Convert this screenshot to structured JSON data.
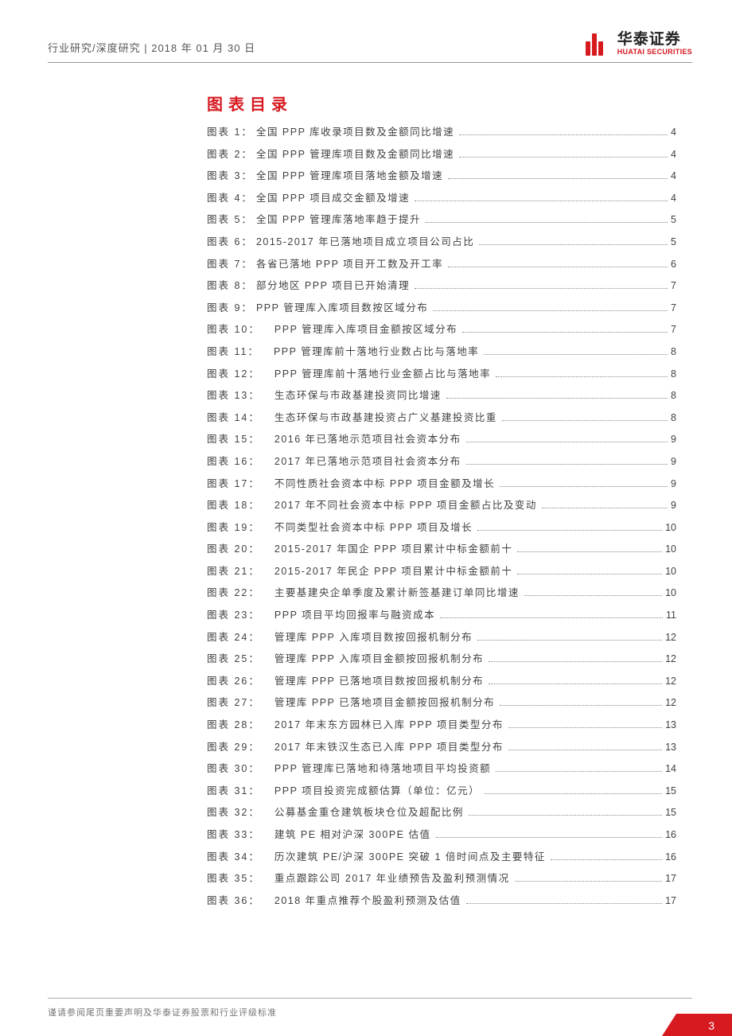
{
  "header": {
    "breadcrumb": "行业研究/深度研究 | 2018 年 01 月 30 日"
  },
  "logo": {
    "cn": "华泰证券",
    "en": "HUATAI SECURITIES"
  },
  "tocTitle": "图表目录",
  "toc": [
    {
      "label": "图表 1：",
      "text": "全国 PPP 库收录项目数及金额同比增速",
      "page": "4"
    },
    {
      "label": "图表 2：",
      "text": "全国 PPP 管理库项目数及金额同比增速",
      "page": "4"
    },
    {
      "label": "图表 3：",
      "text": "全国 PPP 管理库项目落地金额及增速",
      "page": "4"
    },
    {
      "label": "图表 4：",
      "text": "全国 PPP 项目成交金额及增速",
      "page": "4"
    },
    {
      "label": "图表 5：",
      "text": "全国 PPP 管理库落地率趋于提升",
      "page": "5"
    },
    {
      "label": "图表 6：",
      "text": "2015-2017 年已落地项目成立项目公司占比",
      "page": "5"
    },
    {
      "label": "图表 7：",
      "text": "各省已落地 PPP 项目开工数及开工率",
      "page": "6"
    },
    {
      "label": "图表 8：",
      "text": "部分地区 PPP 项目已开始清理",
      "page": "7"
    },
    {
      "label": "图表 9：",
      "text": "PPP 管理库入库项目数按区域分布",
      "page": "7"
    },
    {
      "label": "图表 10：",
      "text": "PPP 管理库入库项目金额按区域分布",
      "page": "7"
    },
    {
      "label": "图表 11：",
      "text": "PPP 管理库前十落地行业数占比与落地率",
      "page": "8"
    },
    {
      "label": "图表 12：",
      "text": "PPP 管理库前十落地行业金额占比与落地率",
      "page": "8"
    },
    {
      "label": "图表 13：",
      "text": "生态环保与市政基建投资同比增速",
      "page": "8"
    },
    {
      "label": "图表 14：",
      "text": "生态环保与市政基建投资占广义基建投资比重",
      "page": "8"
    },
    {
      "label": "图表 15：",
      "text": "2016 年已落地示范项目社会资本分布",
      "page": "9"
    },
    {
      "label": "图表 16：",
      "text": "2017 年已落地示范项目社会资本分布",
      "page": "9"
    },
    {
      "label": "图表 17：",
      "text": "不同性质社会资本中标 PPP 项目金额及增长",
      "page": "9"
    },
    {
      "label": "图表 18：",
      "text": "2017 年不同社会资本中标 PPP 项目金额占比及变动",
      "page": "9"
    },
    {
      "label": "图表 19：",
      "text": "不同类型社会资本中标 PPP 项目及增长",
      "page": "10"
    },
    {
      "label": "图表 20：",
      "text": "2015-2017 年国企 PPP 项目累计中标金额前十",
      "page": "10"
    },
    {
      "label": "图表 21：",
      "text": "2015-2017 年民企 PPP 项目累计中标金额前十",
      "page": "10"
    },
    {
      "label": "图表 22：",
      "text": "主要基建央企单季度及累计新签基建订单同比增速",
      "page": "10"
    },
    {
      "label": "图表 23：",
      "text": "PPP 项目平均回报率与融资成本",
      "page": "11"
    },
    {
      "label": "图表 24：",
      "text": "管理库 PPP 入库项目数按回报机制分布",
      "page": "12"
    },
    {
      "label": "图表 25：",
      "text": "管理库 PPP 入库项目金额按回报机制分布",
      "page": "12"
    },
    {
      "label": "图表 26：",
      "text": "管理库 PPP 已落地项目数按回报机制分布",
      "page": "12"
    },
    {
      "label": "图表 27：",
      "text": "管理库 PPP 已落地项目金额按回报机制分布",
      "page": "12"
    },
    {
      "label": "图表 28：",
      "text": "2017 年末东方园林已入库 PPP 项目类型分布",
      "page": "13"
    },
    {
      "label": "图表 29：",
      "text": "2017 年末铁汉生态已入库 PPP 项目类型分布",
      "page": "13"
    },
    {
      "label": "图表 30：",
      "text": "PPP 管理库已落地和待落地项目平均投资额",
      "page": "14"
    },
    {
      "label": "图表 31：",
      "text": "PPP 项目投资完成额估算（单位：亿元）",
      "page": "15"
    },
    {
      "label": "图表 32：",
      "text": "公募基金重仓建筑板块仓位及超配比例",
      "page": "15"
    },
    {
      "label": "图表 33：",
      "text": "建筑 PE 相对沪深 300PE 估值",
      "page": "16"
    },
    {
      "label": "图表 34：",
      "text": "历次建筑 PE/沪深 300PE 突破 1 倍时间点及主要特征",
      "page": "16"
    },
    {
      "label": "图表 35：",
      "text": "重点跟踪公司 2017 年业绩预告及盈利预测情况",
      "page": "17"
    },
    {
      "label": "图表 36：",
      "text": "2018 年重点推荐个股盈利预测及估值",
      "page": "17"
    }
  ],
  "footer": {
    "disclaimer": "谨请参阅尾页重要声明及华泰证券股票和行业评级标准",
    "pageNumber": "3"
  }
}
